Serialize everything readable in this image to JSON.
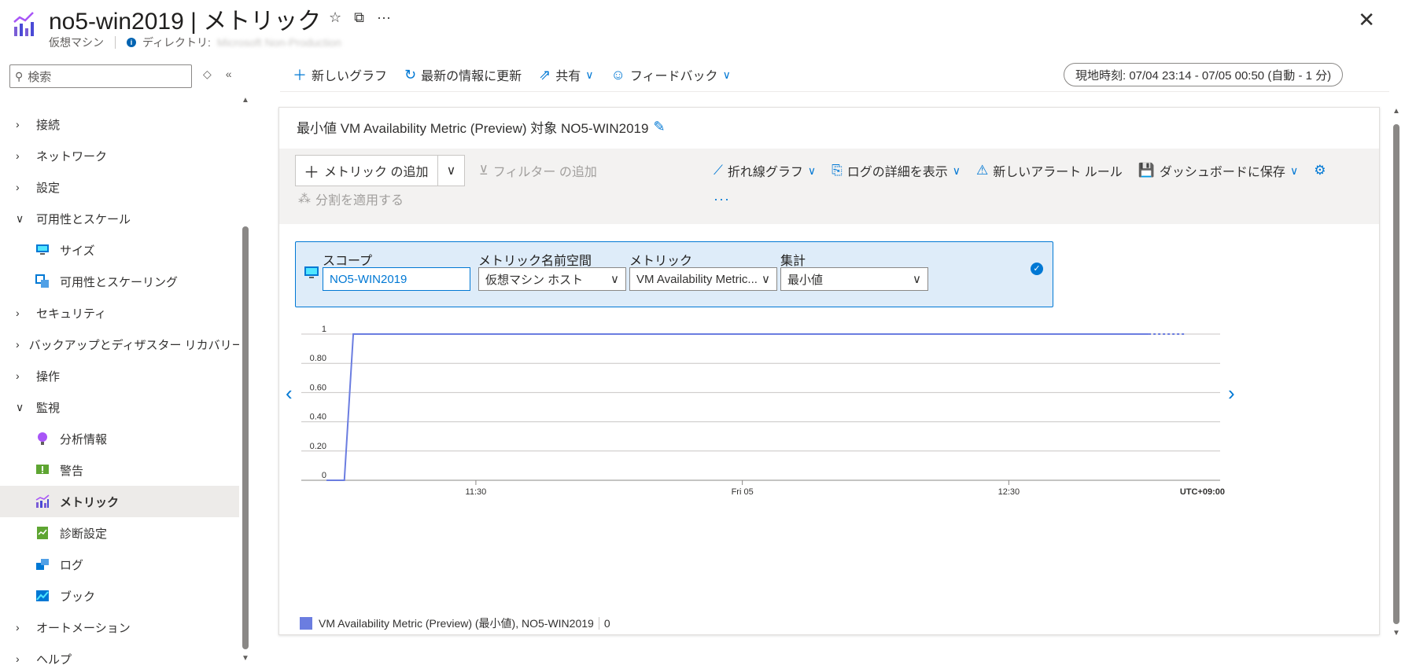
{
  "header": {
    "title": "no5-win2019 | メトリック",
    "subtitle_type": "仮想マシン",
    "directory_label": "ディレクトリ:",
    "directory_value": "Microsoft Non-Production",
    "star_icon": "☆",
    "copy_icon": "⧉",
    "more_icon": "···",
    "close_icon": "✕"
  },
  "sidebar": {
    "search_placeholder": "検索",
    "items": [
      {
        "label": "接続",
        "type": "group"
      },
      {
        "label": "ネットワーク",
        "type": "group"
      },
      {
        "label": "設定",
        "type": "group"
      },
      {
        "label": "可用性とスケール",
        "type": "group-open"
      },
      {
        "label": "サイズ",
        "type": "child",
        "icon": "monitor-icon"
      },
      {
        "label": "可用性とスケーリング",
        "type": "child",
        "icon": "availability-icon"
      },
      {
        "label": "セキュリティ",
        "type": "group"
      },
      {
        "label": "バックアップとディザスター リカバリー",
        "type": "group"
      },
      {
        "label": "操作",
        "type": "group"
      },
      {
        "label": "監視",
        "type": "group-open"
      },
      {
        "label": "分析情報",
        "type": "child",
        "icon": "bulb-icon"
      },
      {
        "label": "警告",
        "type": "child",
        "icon": "alert-icon"
      },
      {
        "label": "メトリック",
        "type": "child",
        "icon": "metrics-icon",
        "selected": true
      },
      {
        "label": "診断設定",
        "type": "child",
        "icon": "diagnostic-icon"
      },
      {
        "label": "ログ",
        "type": "child",
        "icon": "logs-icon"
      },
      {
        "label": "ブック",
        "type": "child",
        "icon": "workbook-icon"
      },
      {
        "label": "オートメーション",
        "type": "group"
      },
      {
        "label": "ヘルプ",
        "type": "group"
      }
    ]
  },
  "toolbar": {
    "new_chart": "新しいグラフ",
    "refresh": "最新の情報に更新",
    "share": "共有",
    "feedback": "フィードバック",
    "time_range": "現地時刻: 07/04 23:14 - 07/05 00:50 (自動 - 1 分)"
  },
  "card": {
    "title": "最小値 VM Availability Metric (Preview) 対象 NO5-WIN2019",
    "add_metric": "メトリック の追加",
    "add_filter": "フィルター の追加",
    "apply_split": "分割を適用する",
    "line_chart": "折れ線グラフ",
    "log_details": "ログの詳細を表示",
    "new_alert": "新しいアラート ルール",
    "save_dashboard": "ダッシュボードに保存",
    "more": "···"
  },
  "metric_row": {
    "scope_label": "スコープ",
    "scope_value": "NO5-WIN2019",
    "namespace_label": "メトリック名前空間",
    "namespace_value": "仮想マシン ホスト",
    "metric_label": "メトリック",
    "metric_value": "VM Availability Metric...",
    "aggregation_label": "集計",
    "aggregation_value": "最小値"
  },
  "chart_data": {
    "type": "line",
    "y_ticks": [
      "0",
      "0.20",
      "0.40",
      "0.60",
      "0.80",
      "1"
    ],
    "ylim": [
      0,
      1
    ],
    "x_ticks": [
      "11:30",
      "Fri 05",
      "12:30"
    ],
    "timezone": "UTC+09:00",
    "series": [
      {
        "name": "VM Availability Metric (Preview) (最小値), NO5-WIN2019",
        "color": "#6b7de0",
        "points": [
          [
            0.0,
            0
          ],
          [
            0.01,
            0
          ],
          [
            0.02,
            0
          ],
          [
            0.03,
            1
          ],
          [
            0.92,
            1
          ]
        ],
        "dotted_tail": [
          [
            0.92,
            1
          ],
          [
            0.96,
            1
          ]
        ]
      }
    ]
  },
  "legend": {
    "label": "VM Availability Metric (Preview) (最小値), NO5-WIN2019",
    "value": "0"
  }
}
